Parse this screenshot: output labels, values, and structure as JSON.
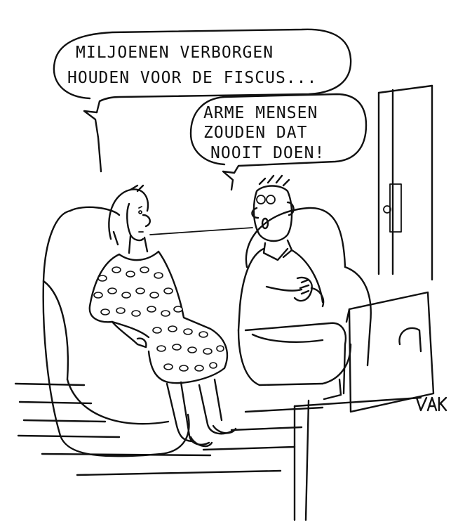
{
  "speech": {
    "woman": {
      "line1": "MILJOENEN VERBORGEN",
      "line2": "HOUDEN VOOR DE FISCUS..."
    },
    "man": {
      "line1": "ARME MENSEN",
      "line2": "ZOUDEN DAT",
      "line3": "NOOIT DOEN!"
    }
  },
  "signature": "VAK",
  "colors": {
    "ink": "#111111",
    "paper": "#ffffff"
  }
}
